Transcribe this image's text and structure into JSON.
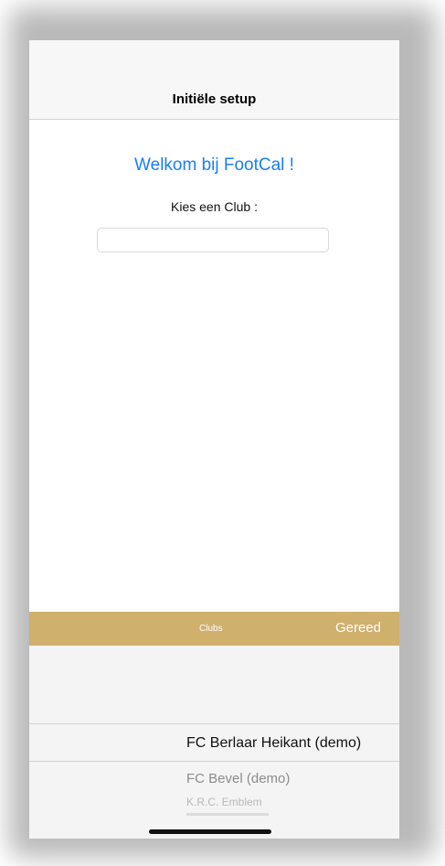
{
  "nav": {
    "title": "Initiële setup"
  },
  "main": {
    "welcome": "Welkom bij FootCal !",
    "choose_label": "Kies een Club :",
    "club_input_value": ""
  },
  "picker_toolbar": {
    "title": "Clubs",
    "done_label": "Gereed",
    "background_color": "#cfb06d"
  },
  "picker": {
    "selected": "FC Berlaar Heikant (demo)",
    "options": [
      "FC Bevel (demo)",
      "K.R.C. Emblem"
    ]
  },
  "colors": {
    "accent": "#1a7ff2"
  }
}
